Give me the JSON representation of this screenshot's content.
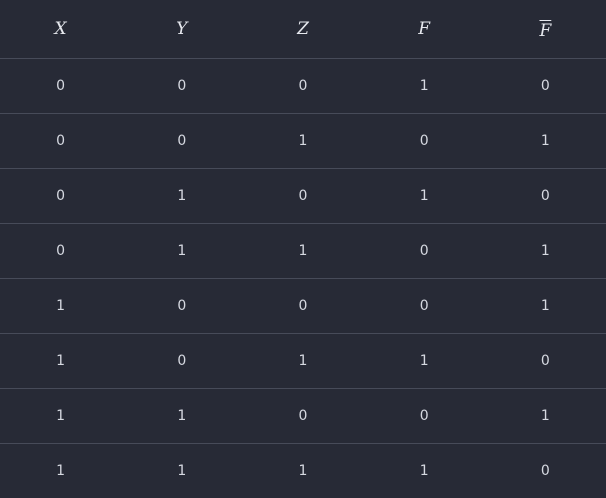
{
  "table": {
    "headers": [
      "X",
      "Y",
      "Z",
      "F",
      "F"
    ],
    "rows": [
      [
        "0",
        "0",
        "0",
        "1",
        "0"
      ],
      [
        "0",
        "0",
        "1",
        "0",
        "1"
      ],
      [
        "0",
        "1",
        "0",
        "1",
        "0"
      ],
      [
        "0",
        "1",
        "1",
        "0",
        "1"
      ],
      [
        "1",
        "0",
        "0",
        "0",
        "1"
      ],
      [
        "1",
        "0",
        "1",
        "1",
        "0"
      ],
      [
        "1",
        "1",
        "0",
        "0",
        "1"
      ],
      [
        "1",
        "1",
        "1",
        "1",
        "0"
      ]
    ]
  }
}
